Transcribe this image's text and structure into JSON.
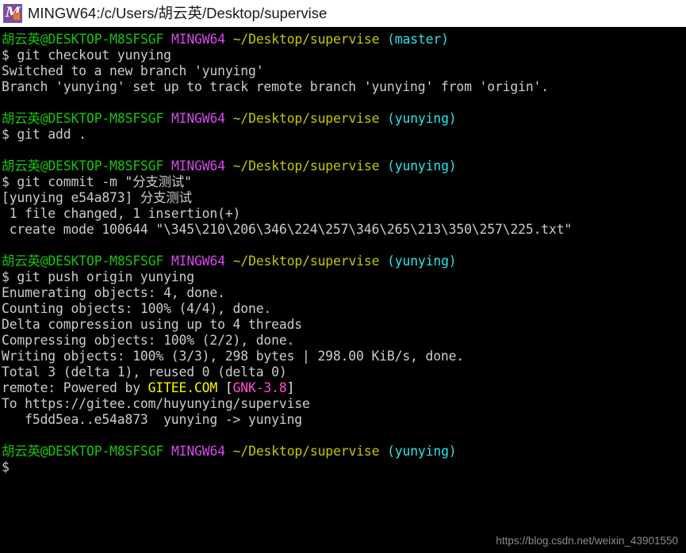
{
  "window": {
    "title": "MINGW64:/c/Users/胡云英/Desktop/supervise",
    "icon": "mingw-icon",
    "background_color": "#000000",
    "titlebar_background": "#ffffff"
  },
  "colors": {
    "default_text": "#cccccc",
    "user_host": "#16c60c",
    "shell_name": "#d946ef",
    "path": "#c5c900",
    "branch": "#2ee5e5",
    "gitee_brand": "#f7f700",
    "gnk_version": "#ff4fd8"
  },
  "prompt": {
    "user_host": "胡云英@DESKTOP-M8SFSGF",
    "shell": "MINGW64",
    "path": "~/Desktop/supervise",
    "branch_master": "(master)",
    "branch_yunying": "(yunying)",
    "dollar": "$"
  },
  "terminal": {
    "blocks": [
      {
        "prompt_branch": "(master)",
        "command": "$ git checkout yunying",
        "output": [
          "Switched to a new branch 'yunying'",
          "Branch 'yunying' set up to track remote branch 'yunying' from 'origin'."
        ]
      },
      {
        "prompt_branch": "(yunying)",
        "command": "$ git add .",
        "output": []
      },
      {
        "prompt_branch": "(yunying)",
        "command": "$ git commit -m \"分支测试\"",
        "output": [
          "[yunying e54a873] 分支测试",
          " 1 file changed, 1 insertion(+)",
          " create mode 100644 \"\\345\\210\\206\\346\\224\\257\\346\\265\\213\\350\\257\\225.txt\""
        ]
      },
      {
        "prompt_branch": "(yunying)",
        "command": "$ git push origin yunying",
        "output": [
          "Enumerating objects: 4, done.",
          "Counting objects: 100% (4/4), done.",
          "Delta compression using up to 4 threads",
          "Compressing objects: 100% (2/2), done.",
          "Writing objects: 100% (3/3), 298 bytes | 298.00 KiB/s, done.",
          "Total 3 (delta 1), reused 0 (delta 0)",
          "To https://gitee.com/huyunying/supervise",
          "   f5dd5ea..e54a873  yunying -> yunying"
        ]
      }
    ],
    "remote_line": {
      "prefix": "remote: Powered by ",
      "brand": "GITEE.COM",
      "bracket_open": " [",
      "version": "GNK-3.8",
      "bracket_close": "]"
    },
    "lines": {
      "l_checkout_cmd": "$ git checkout yunying",
      "l_switched": "Switched to a new branch 'yunying'",
      "l_track": "Branch 'yunying' set up to track remote branch 'yunying' from 'origin'.",
      "l_add_cmd": "$ git add .",
      "l_commit_cmd": "$ git commit -m \"分支测试\"",
      "l_commit_result": "[yunying e54a873] 分支测试",
      "l_file_changed": " 1 file changed, 1 insertion(+)",
      "l_create_mode": " create mode 100644 \"\\345\\210\\206\\346\\224\\257\\346\\265\\213\\350\\257\\225.txt\"",
      "l_push_cmd": "$ git push origin yunying",
      "l_enumerating": "Enumerating objects: 4, done.",
      "l_counting": "Counting objects: 100% (4/4), done.",
      "l_delta": "Delta compression using up to 4 threads",
      "l_compressing": "Compressing objects: 100% (2/2), done.",
      "l_writing": "Writing objects: 100% (3/3), 298 bytes | 298.00 KiB/s, done.",
      "l_total": "Total 3 (delta 1), reused 0 (delta 0)",
      "l_to_url": "To https://gitee.com/huyunying/supervise",
      "l_refspec": "   f5dd5ea..e54a873  yunying -> yunying",
      "l_final_prompt": "$"
    }
  },
  "watermark": {
    "text": "https://blog.csdn.net/weixin_43901550"
  }
}
